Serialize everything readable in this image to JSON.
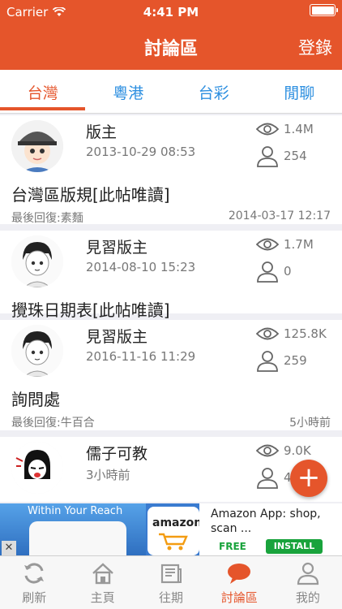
{
  "status": {
    "carrier": "Carrier",
    "time": "4:41 PM"
  },
  "header": {
    "title": "討論區",
    "login": "登錄"
  },
  "tabs": [
    {
      "label": "台灣",
      "active": true
    },
    {
      "label": "粵港",
      "active": false
    },
    {
      "label": "台彩",
      "active": false
    },
    {
      "label": "閒聊",
      "active": false
    }
  ],
  "posts": [
    {
      "author": "版主",
      "date": "2013-10-29 08:53",
      "views": "1.4M",
      "replies": "254",
      "title": "台灣區版規[此帖唯讀]",
      "last_reply": "最後回復:素麵",
      "last_time": "2014-03-17 12:17"
    },
    {
      "author": "見習版主",
      "date": "2014-08-10 15:23",
      "views": "1.7M",
      "replies": "0",
      "title": "攪珠日期表[此帖唯讀]",
      "last_reply": "",
      "last_time": ""
    },
    {
      "author": "見習版主",
      "date": "2016-11-16 11:29",
      "views": "125.8K",
      "replies": "259",
      "title": "詢問處",
      "last_reply": "最後回復:牛百合",
      "last_time": "5小時前"
    },
    {
      "author": "儒子可教",
      "date": "3小時前",
      "views": "9.0K",
      "replies": "4",
      "title": "",
      "last_reply": "",
      "last_time": ""
    }
  ],
  "fab": {
    "label": "+"
  },
  "ad": {
    "tagline": "Within Your Reach",
    "logo": "amazon",
    "title": "Amazon App: shop, scan ...",
    "free": "FREE",
    "install": "INSTALL",
    "close": "✕"
  },
  "tabbar": [
    {
      "label": "刷新",
      "icon": "refresh-icon",
      "active": false
    },
    {
      "label": "主頁",
      "icon": "home-icon",
      "active": false
    },
    {
      "label": "往期",
      "icon": "newspaper-icon",
      "active": false
    },
    {
      "label": "討論區",
      "icon": "chat-bubble-icon",
      "active": true
    },
    {
      "label": "我的",
      "icon": "person-icon",
      "active": false
    }
  ],
  "colors": {
    "accent": "#e5552b",
    "link": "#2d8fe0",
    "muted": "#777777"
  }
}
